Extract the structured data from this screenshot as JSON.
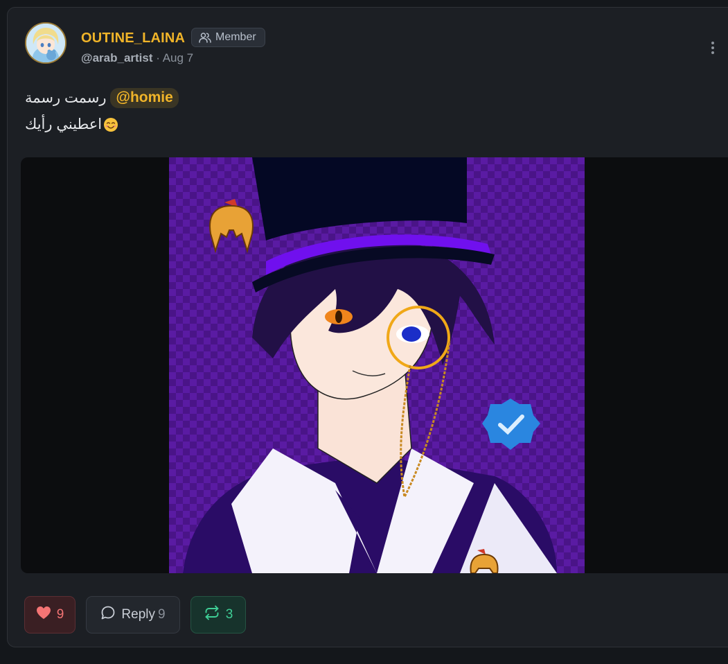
{
  "post": {
    "author_name": "OUTINE_LAINA",
    "role_badge": "Member",
    "handle": "@arab_artist",
    "separator": " · ",
    "date": "Aug 7",
    "text_line1": "رسمت رسمة",
    "mention": "@homie",
    "text_line2": "اعطيني رأيك"
  },
  "actions": {
    "likes": "9",
    "reply_label": "Reply",
    "reply_count": "9",
    "reposts": "3"
  },
  "icons": {
    "role": "users-icon",
    "more": "more-vertical-icon",
    "like": "heart-icon",
    "reply": "speech-bubble-icon",
    "repost": "repost-arrows-icon",
    "emoji": "smiling-face-icon"
  },
  "colors": {
    "accent": "#f0b429",
    "like": "#f47474",
    "repost": "#3fcf96",
    "card_bg": "#1c1f24"
  }
}
